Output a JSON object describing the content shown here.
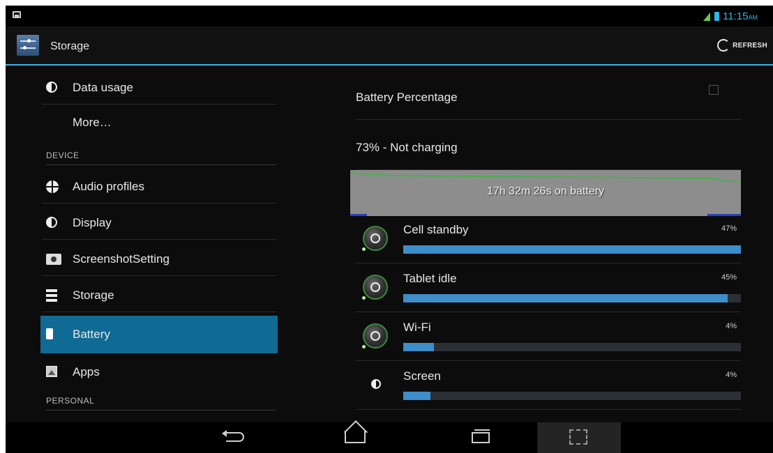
{
  "status_bar": {
    "time": "11:15",
    "ampm": "AM"
  },
  "action_bar": {
    "title": "Storage",
    "refresh_label": "REFRESH"
  },
  "left_menu": {
    "items": [
      {
        "label": "Data usage",
        "icon": "data-usage-icon"
      },
      {
        "label": "More…",
        "icon": ""
      },
      {
        "section": "DEVICE"
      },
      {
        "label": "Audio profiles",
        "icon": "audio-profiles-icon"
      },
      {
        "label": "Display",
        "icon": "display-icon"
      },
      {
        "label": "ScreenshotSetting",
        "icon": "camera-icon"
      },
      {
        "label": "Storage",
        "icon": "storage-icon"
      },
      {
        "label": "Battery",
        "icon": "battery-icon",
        "selected": true
      },
      {
        "label": "Apps",
        "icon": "apps-icon"
      },
      {
        "section": "PERSONAL"
      }
    ]
  },
  "battery": {
    "percentage_label": "Battery Percentage",
    "status": "73% - Not charging",
    "graph_label": "17h 32m 26s on battery",
    "usage": [
      {
        "name": "Cell standby",
        "percent_label": "47%",
        "fill": 1.0,
        "icon": "cell-standby-icon"
      },
      {
        "name": "Tablet idle",
        "percent_label": "45%",
        "fill": 0.96,
        "icon": "tablet-idle-icon"
      },
      {
        "name": "Wi-Fi",
        "percent_label": "4%",
        "fill": 0.09,
        "icon": "wifi-icon"
      },
      {
        "name": "Screen",
        "percent_label": "4%",
        "fill": 0.08,
        "icon": "screen-brightness-icon"
      }
    ]
  },
  "colors": {
    "accent": "#33b5e5",
    "selected_row": "#0f6a94",
    "bar_fill": "#3d8ec9",
    "graph_line": "#4caf50"
  }
}
